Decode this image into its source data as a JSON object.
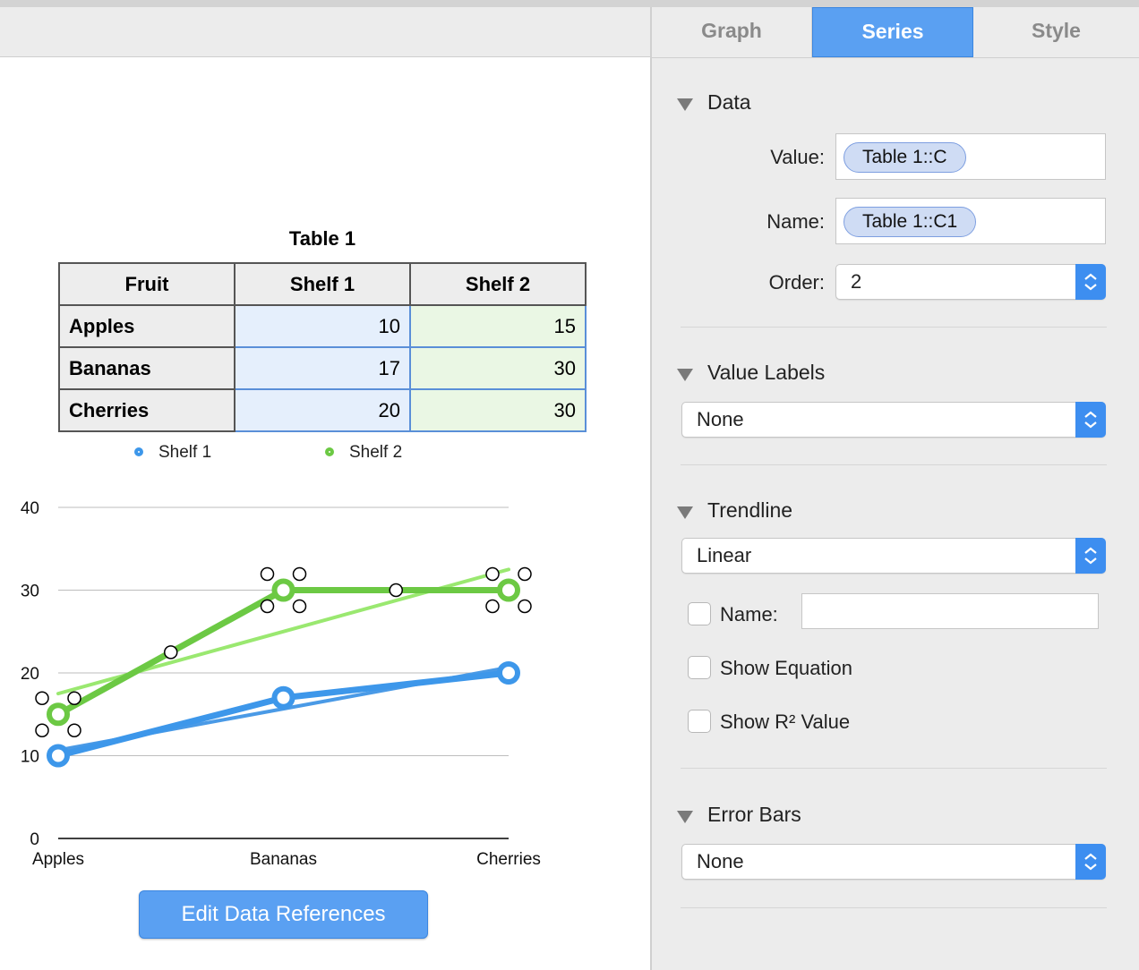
{
  "inspector": {
    "tabs": [
      {
        "label": "Graph",
        "active": false
      },
      {
        "label": "Series",
        "active": true
      },
      {
        "label": "Style",
        "active": false
      }
    ],
    "data_section": {
      "title": "Data",
      "value_label": "Value:",
      "value_token": "Table 1::C",
      "name_label": "Name:",
      "name_token": "Table 1::C1",
      "order_label": "Order:",
      "order_value": "2"
    },
    "value_labels_section": {
      "title": "Value Labels",
      "selected": "None"
    },
    "trendline_section": {
      "title": "Trendline",
      "selected": "Linear",
      "name_checkbox_label": "Name:",
      "name_value": "",
      "show_equation_label": "Show Equation",
      "show_r2_label": "Show R² Value"
    },
    "error_bars_section": {
      "title": "Error Bars",
      "selected": "None"
    }
  },
  "table": {
    "title": "Table 1",
    "headers": [
      "Fruit",
      "Shelf 1",
      "Shelf 2"
    ],
    "rows": [
      [
        "Apples",
        "10",
        "15"
      ],
      [
        "Bananas",
        "17",
        "30"
      ],
      [
        "Cherries",
        "20",
        "30"
      ]
    ]
  },
  "edit_button_label": "Edit Data References",
  "colors": {
    "shelf1": "#3d97ea",
    "shelf2": "#6cc944",
    "trend1": "#4a9ae6",
    "trend2": "#9ae870",
    "accent": "#5aa0f2"
  },
  "chart_data": {
    "type": "line",
    "categories": [
      "Apples",
      "Bananas",
      "Cherries"
    ],
    "series": [
      {
        "name": "Shelf 1",
        "values": [
          10,
          17,
          20
        ],
        "trendline": "linear"
      },
      {
        "name": "Shelf 2",
        "values": [
          15,
          30,
          30
        ],
        "trendline": "linear"
      }
    ],
    "y_ticks": [
      "0",
      "10",
      "20",
      "30",
      "40"
    ],
    "ylim": [
      0,
      40
    ],
    "grid": true,
    "legend": "top"
  }
}
